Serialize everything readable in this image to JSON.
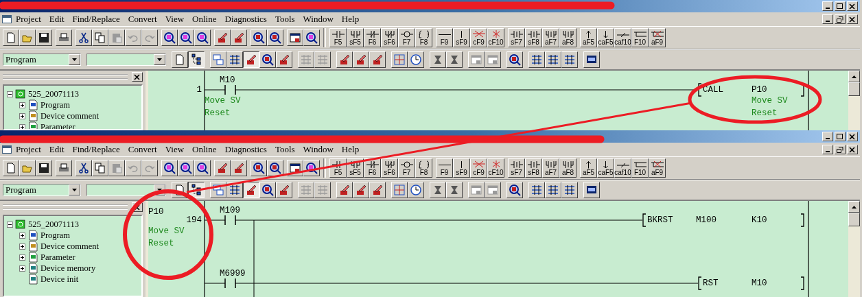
{
  "windows": [
    {
      "menu": [
        "Project",
        "Edit",
        "Find/Replace",
        "Convert",
        "View",
        "Online",
        "Diagnostics",
        "Tools",
        "Window",
        "Help"
      ],
      "tool_groups": [
        [
          {
            "kind": "new",
            "disabled": false
          },
          {
            "kind": "open",
            "disabled": false
          },
          {
            "kind": "save",
            "disabled": false
          }
        ],
        [
          {
            "kind": "print",
            "disabled": false
          }
        ],
        [
          {
            "kind": "cut",
            "disabled": false
          },
          {
            "kind": "copy",
            "disabled": false
          },
          {
            "kind": "paste",
            "disabled": true
          },
          {
            "kind": "undo",
            "disabled": true
          },
          {
            "kind": "redo",
            "disabled": true
          }
        ],
        [
          {
            "kind": "find",
            "disabled": false
          },
          {
            "kind": "find",
            "disabled": false
          },
          {
            "kind": "find",
            "disabled": false
          }
        ],
        [
          {
            "kind": "write",
            "disabled": false
          },
          {
            "kind": "write",
            "disabled": false
          }
        ],
        [
          {
            "kind": "zoom",
            "disabled": false
          },
          {
            "kind": "zoom",
            "disabled": false
          }
        ],
        [
          {
            "kind": "window",
            "disabled": false
          },
          {
            "kind": "find",
            "disabled": false
          }
        ]
      ],
      "key_groups": [
        [
          {
            "kind": "no",
            "label": "F5"
          },
          {
            "kind": "par_no",
            "label": "sF5"
          },
          {
            "kind": "nc",
            "label": "F6"
          },
          {
            "kind": "par_nc",
            "label": "sF6"
          },
          {
            "kind": "coil",
            "label": "F7"
          },
          {
            "kind": "func",
            "label": "F8"
          }
        ],
        [
          {
            "kind": "hline",
            "label": "F9"
          },
          {
            "kind": "vline",
            "label": "sF9"
          },
          {
            "kind": "del_h",
            "label": "cF9"
          },
          {
            "kind": "del_v",
            "label": "cF10"
          }
        ],
        [
          {
            "kind": "pulse",
            "label": "sF7"
          },
          {
            "kind": "pulse",
            "label": "sF8"
          },
          {
            "kind": "par_pulse",
            "label": "aF7"
          },
          {
            "kind": "par_pulse",
            "label": "aF8"
          }
        ],
        [
          {
            "kind": "up",
            "label": "aF5"
          },
          {
            "kind": "down",
            "label": "caF5"
          },
          {
            "kind": "invert",
            "label": "caf10"
          },
          {
            "kind": "draw",
            "label": "F10"
          },
          {
            "kind": "erase",
            "label": "aF9"
          }
        ]
      ],
      "mode_select": "Program",
      "view_groups": [
        [
          {
            "kind": "doc",
            "disabled": false,
            "selected": false
          },
          {
            "kind": "tree",
            "disabled": false,
            "selected": true
          }
        ],
        [
          {
            "kind": "ladder",
            "disabled": false,
            "selected": false
          },
          {
            "kind": "list",
            "disabled": false,
            "selected": false
          },
          {
            "kind": "edit",
            "disabled": false,
            "selected": true
          },
          {
            "kind": "zoom",
            "disabled": false,
            "selected": false
          },
          {
            "kind": "write",
            "disabled": false,
            "selected": false
          }
        ],
        [
          {
            "kind": "list",
            "disabled": true,
            "selected": false
          },
          {
            "kind": "list",
            "disabled": true,
            "selected": false
          }
        ],
        [
          {
            "kind": "edit",
            "disabled": false,
            "selected": false
          },
          {
            "kind": "edit",
            "disabled": false,
            "selected": false
          },
          {
            "kind": "edit",
            "disabled": false,
            "selected": false
          }
        ],
        [
          {
            "kind": "grid",
            "disabled": false,
            "selected": false
          },
          {
            "kind": "clock",
            "disabled": false,
            "selected": false
          }
        ],
        [
          {
            "kind": "step",
            "disabled": false,
            "selected": false
          },
          {
            "kind": "step",
            "disabled": false,
            "selected": false
          }
        ],
        [
          {
            "kind": "window",
            "disabled": true,
            "selected": false
          },
          {
            "kind": "window",
            "disabled": true,
            "selected": false
          }
        ],
        [
          {
            "kind": "zoom",
            "disabled": false,
            "selected": false
          }
        ],
        [
          {
            "kind": "list",
            "disabled": false,
            "selected": false
          },
          {
            "kind": "list",
            "disabled": false,
            "selected": false
          },
          {
            "kind": "list",
            "disabled": false,
            "selected": false
          }
        ],
        [
          {
            "kind": "monitor",
            "disabled": false,
            "selected": false
          }
        ]
      ],
      "tree": {
        "label": "525_20071113",
        "expanded": true,
        "children": [
          {
            "label": "Program",
            "kind": "program",
            "expandable": true,
            "expanded": false
          },
          {
            "label": "Device comment",
            "kind": "comment",
            "expandable": true,
            "expanded": false
          },
          {
            "label": "Parameter",
            "kind": "parameter",
            "expandable": true,
            "expanded": false
          }
        ]
      },
      "ladder": {
        "rungs": [
          {
            "step": "1",
            "rows": [
              {
                "contact": "M10",
                "contact_comment": [
                  "Move SV",
                  "Reset"
                ],
                "instruction": "CALL",
                "operands": [
                  "P10"
                ],
                "operand_comment": [
                  "Move SV",
                  "Reset"
                ]
              }
            ]
          }
        ]
      }
    },
    {
      "menu": [
        "Project",
        "Edit",
        "Find/Replace",
        "Convert",
        "View",
        "Online",
        "Diagnostics",
        "Tools",
        "Window",
        "Help"
      ],
      "tool_groups": [
        [
          {
            "kind": "new",
            "disabled": false
          },
          {
            "kind": "open",
            "disabled": false
          },
          {
            "kind": "save",
            "disabled": false
          }
        ],
        [
          {
            "kind": "print",
            "disabled": false
          }
        ],
        [
          {
            "kind": "cut",
            "disabled": false
          },
          {
            "kind": "copy",
            "disabled": false
          },
          {
            "kind": "paste",
            "disabled": true
          },
          {
            "kind": "undo",
            "disabled": true
          },
          {
            "kind": "redo",
            "disabled": true
          }
        ],
        [
          {
            "kind": "find",
            "disabled": false
          },
          {
            "kind": "find",
            "disabled": false
          },
          {
            "kind": "find",
            "disabled": false
          }
        ],
        [
          {
            "kind": "write",
            "disabled": false
          },
          {
            "kind": "write",
            "disabled": false
          }
        ],
        [
          {
            "kind": "zoom",
            "disabled": false
          },
          {
            "kind": "zoom",
            "disabled": false
          }
        ],
        [
          {
            "kind": "window",
            "disabled": false
          },
          {
            "kind": "find",
            "disabled": false
          }
        ]
      ],
      "key_groups": [
        [
          {
            "kind": "no",
            "label": "F5"
          },
          {
            "kind": "par_no",
            "label": "sF5"
          },
          {
            "kind": "nc",
            "label": "F6"
          },
          {
            "kind": "par_nc",
            "label": "sF6"
          },
          {
            "kind": "coil",
            "label": "F7"
          },
          {
            "kind": "func",
            "label": "F8"
          }
        ],
        [
          {
            "kind": "hline",
            "label": "F9"
          },
          {
            "kind": "vline",
            "label": "sF9"
          },
          {
            "kind": "del_h",
            "label": "cF9"
          },
          {
            "kind": "del_v",
            "label": "cF10"
          }
        ],
        [
          {
            "kind": "pulse",
            "label": "sF7"
          },
          {
            "kind": "pulse",
            "label": "sF8"
          },
          {
            "kind": "par_pulse",
            "label": "aF7"
          },
          {
            "kind": "par_pulse",
            "label": "aF8"
          }
        ],
        [
          {
            "kind": "up",
            "label": "aF5"
          },
          {
            "kind": "down",
            "label": "caF5"
          },
          {
            "kind": "invert",
            "label": "caf10"
          },
          {
            "kind": "draw",
            "label": "F10"
          },
          {
            "kind": "erase",
            "label": "aF9"
          }
        ]
      ],
      "mode_select": "Program",
      "view_groups": [
        [
          {
            "kind": "doc",
            "disabled": false,
            "selected": false
          },
          {
            "kind": "tree",
            "disabled": false,
            "selected": true
          }
        ],
        [
          {
            "kind": "ladder",
            "disabled": false,
            "selected": false
          },
          {
            "kind": "list",
            "disabled": false,
            "selected": false
          },
          {
            "kind": "edit",
            "disabled": false,
            "selected": true
          },
          {
            "kind": "zoom",
            "disabled": false,
            "selected": false
          },
          {
            "kind": "write",
            "disabled": false,
            "selected": false
          }
        ],
        [
          {
            "kind": "list",
            "disabled": true,
            "selected": false
          },
          {
            "kind": "list",
            "disabled": true,
            "selected": false
          }
        ],
        [
          {
            "kind": "edit",
            "disabled": false,
            "selected": false
          },
          {
            "kind": "edit",
            "disabled": false,
            "selected": false
          },
          {
            "kind": "edit",
            "disabled": false,
            "selected": false
          }
        ],
        [
          {
            "kind": "grid",
            "disabled": false,
            "selected": false
          },
          {
            "kind": "clock",
            "disabled": false,
            "selected": false
          }
        ],
        [
          {
            "kind": "step",
            "disabled": false,
            "selected": false
          },
          {
            "kind": "step",
            "disabled": false,
            "selected": false
          }
        ],
        [
          {
            "kind": "window",
            "disabled": true,
            "selected": false
          },
          {
            "kind": "window",
            "disabled": true,
            "selected": false
          }
        ],
        [
          {
            "kind": "zoom",
            "disabled": false,
            "selected": false
          }
        ],
        [
          {
            "kind": "list",
            "disabled": false,
            "selected": false
          },
          {
            "kind": "list",
            "disabled": false,
            "selected": false
          },
          {
            "kind": "list",
            "disabled": false,
            "selected": false
          }
        ],
        [
          {
            "kind": "monitor",
            "disabled": false,
            "selected": false
          }
        ]
      ],
      "tree": {
        "label": "525_20071113",
        "expanded": true,
        "children": [
          {
            "label": "Program",
            "kind": "program",
            "expandable": true,
            "expanded": false
          },
          {
            "label": "Device comment",
            "kind": "comment",
            "expandable": true,
            "expanded": false
          },
          {
            "label": "Parameter",
            "kind": "parameter",
            "expandable": true,
            "expanded": false
          },
          {
            "label": "Device memory",
            "kind": "memory",
            "expandable": true,
            "expanded": false
          },
          {
            "label": "Device init",
            "kind": "memory",
            "expandable": false
          }
        ]
      },
      "ladder": {
        "pointer": "P10",
        "pointer_comment": [
          "Move SV",
          "Reset"
        ],
        "rungs": [
          {
            "step": "194",
            "rows": [
              {
                "contact": "M109",
                "instruction": "BKRST",
                "operands": [
                  "M100",
                  "K10"
                ]
              },
              {
                "contact": "M6999",
                "instruction": "RST",
                "operands": [
                  "M10"
                ]
              }
            ]
          }
        ]
      }
    }
  ]
}
